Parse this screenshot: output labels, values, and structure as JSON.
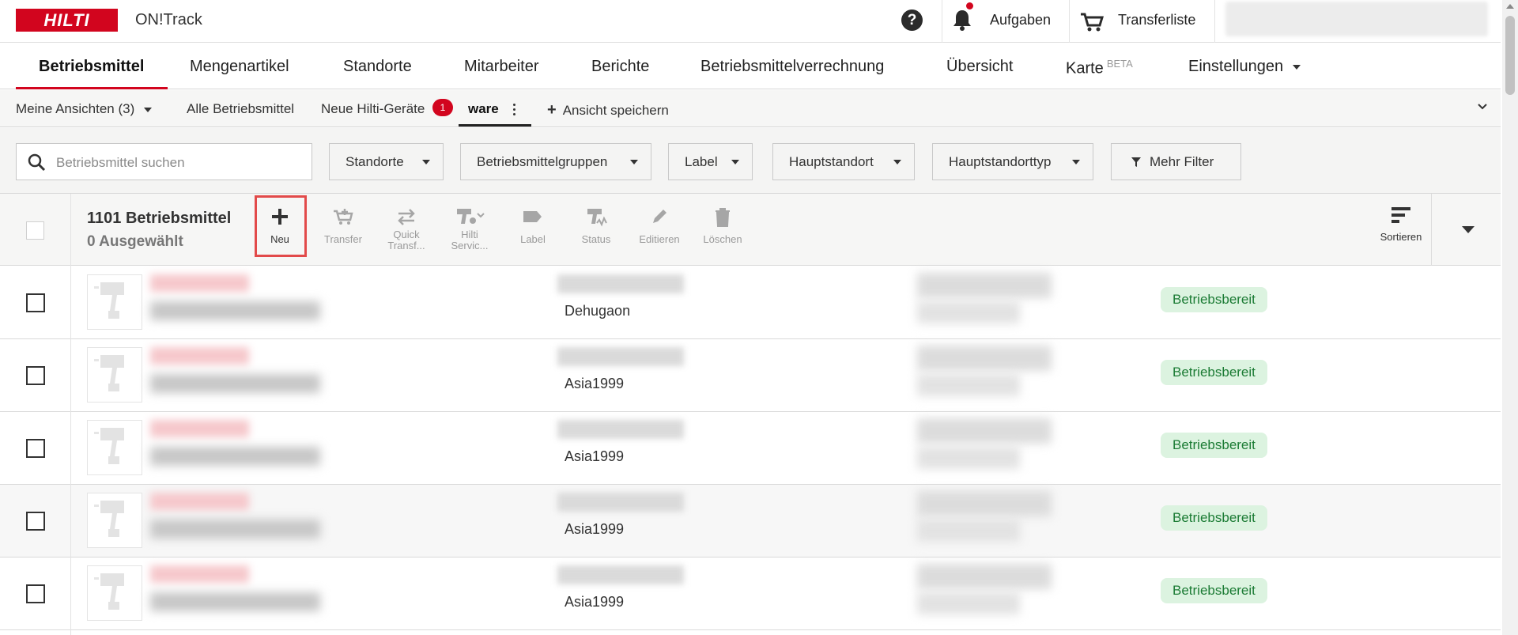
{
  "header": {
    "brand": "HILTI",
    "app_name": "ON!Track",
    "tasks_label": "Aufgaben",
    "transfer_label": "Transferliste"
  },
  "nav": {
    "tabs": [
      {
        "label": "Betriebsmittel"
      },
      {
        "label": "Mengenartikel"
      },
      {
        "label": "Standorte"
      },
      {
        "label": "Mitarbeiter"
      },
      {
        "label": "Berichte"
      },
      {
        "label": "Betriebsmittelverrechnung"
      },
      {
        "label": "Übersicht"
      },
      {
        "label": "Karte"
      },
      {
        "label": "Einstellungen"
      }
    ],
    "karte_badge": "BETA"
  },
  "views": {
    "my_views": "Meine Ansichten",
    "my_views_count": "(3)",
    "all": "Alle Betriebsmittel",
    "new_hilti": "Neue Hilti-Geräte",
    "new_hilti_badge": "1",
    "active": "ware",
    "save": "Ansicht speichern"
  },
  "filters": {
    "search_placeholder": "Betriebsmittel suchen",
    "buttons": [
      "Standorte",
      "Betriebsmittelgruppen",
      "Label",
      "Hauptstandort",
      "Hauptstandorttyp"
    ],
    "more": "Mehr Filter"
  },
  "toolbar": {
    "count": "1101 Betriebsmittel",
    "selected": "0 Ausgewählt",
    "actions": [
      {
        "label": "Neu"
      },
      {
        "label": "Transfer"
      },
      {
        "label": "Quick Transf..."
      },
      {
        "label": "Hilti Servic..."
      },
      {
        "label": "Label"
      },
      {
        "label": "Status"
      },
      {
        "label": "Editieren"
      },
      {
        "label": "Löschen"
      }
    ],
    "sort": "Sortieren"
  },
  "rows": [
    {
      "location": "Dehugaon",
      "status": "Betriebsbereit"
    },
    {
      "location": "Asia1999",
      "status": "Betriebsbereit"
    },
    {
      "location": "Asia1999",
      "status": "Betriebsbereit"
    },
    {
      "location": "Asia1999",
      "status": "Betriebsbereit"
    },
    {
      "location": "Asia1999",
      "status": "Betriebsbereit"
    }
  ],
  "colors": {
    "brand_red": "#d2051e",
    "status_bg": "#dcf3e0",
    "status_text": "#1b7b34"
  }
}
